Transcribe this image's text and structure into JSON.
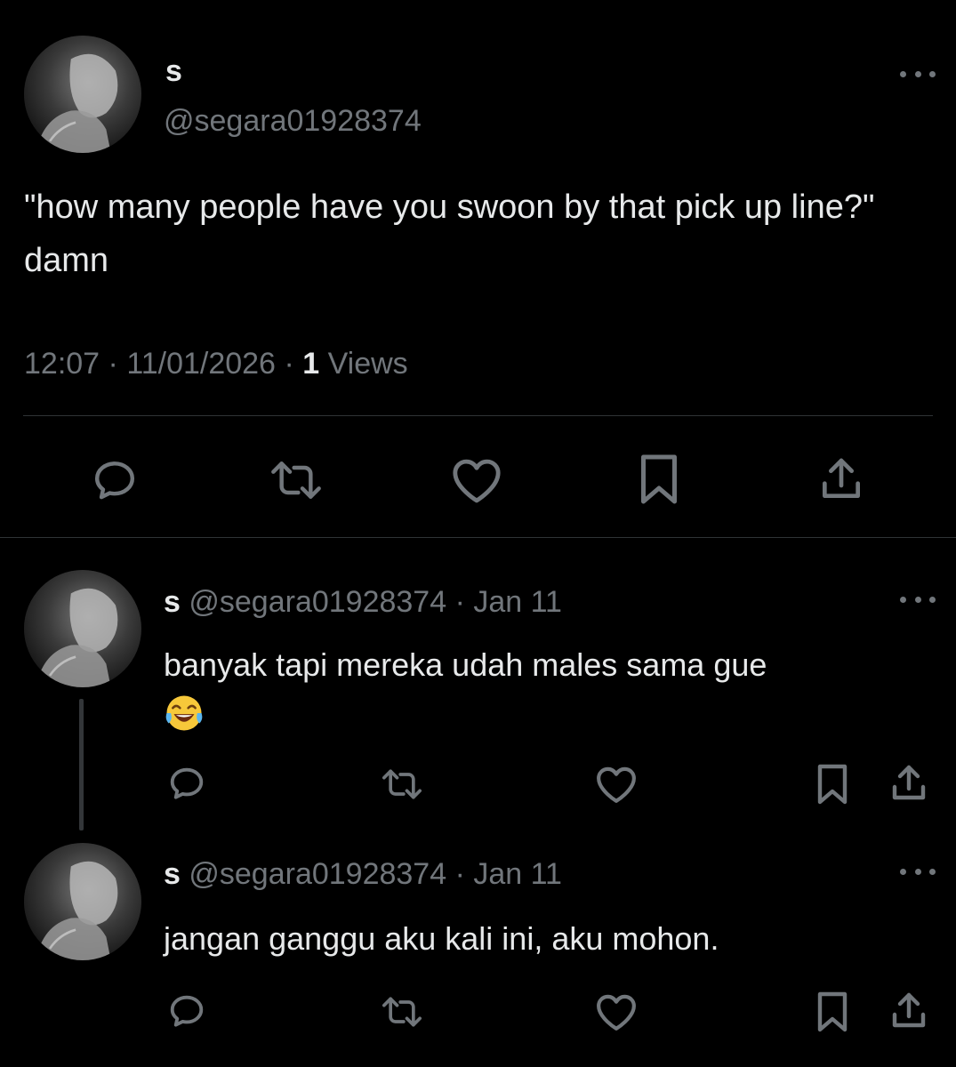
{
  "main_tweet": {
    "display_name": "s",
    "handle": "@segara01928374",
    "text": "\"how many people have you swoon by that pick up line?\" damn",
    "time": "12:07",
    "date": "11/01/2026",
    "separator": "·",
    "views_count": "1",
    "views_label": "Views",
    "actions": [
      "reply-icon",
      "retweet-icon",
      "like-icon",
      "bookmark-icon",
      "share-icon"
    ]
  },
  "replies": [
    {
      "display_name": "s",
      "handle": "@segara01928374",
      "separator": "·",
      "date": "Jan 11",
      "text": "banyak tapi mereka udah males sama gue",
      "emoji": "😂"
    },
    {
      "display_name": "s",
      "handle": "@segara01928374",
      "separator": "·",
      "date": "Jan 11",
      "text": "jangan ganggu aku kali ini, aku mohon."
    }
  ],
  "colors": {
    "background": "#000000",
    "text_primary": "#e7e9ea",
    "text_secondary": "#71767b",
    "divider": "#2f3336"
  }
}
